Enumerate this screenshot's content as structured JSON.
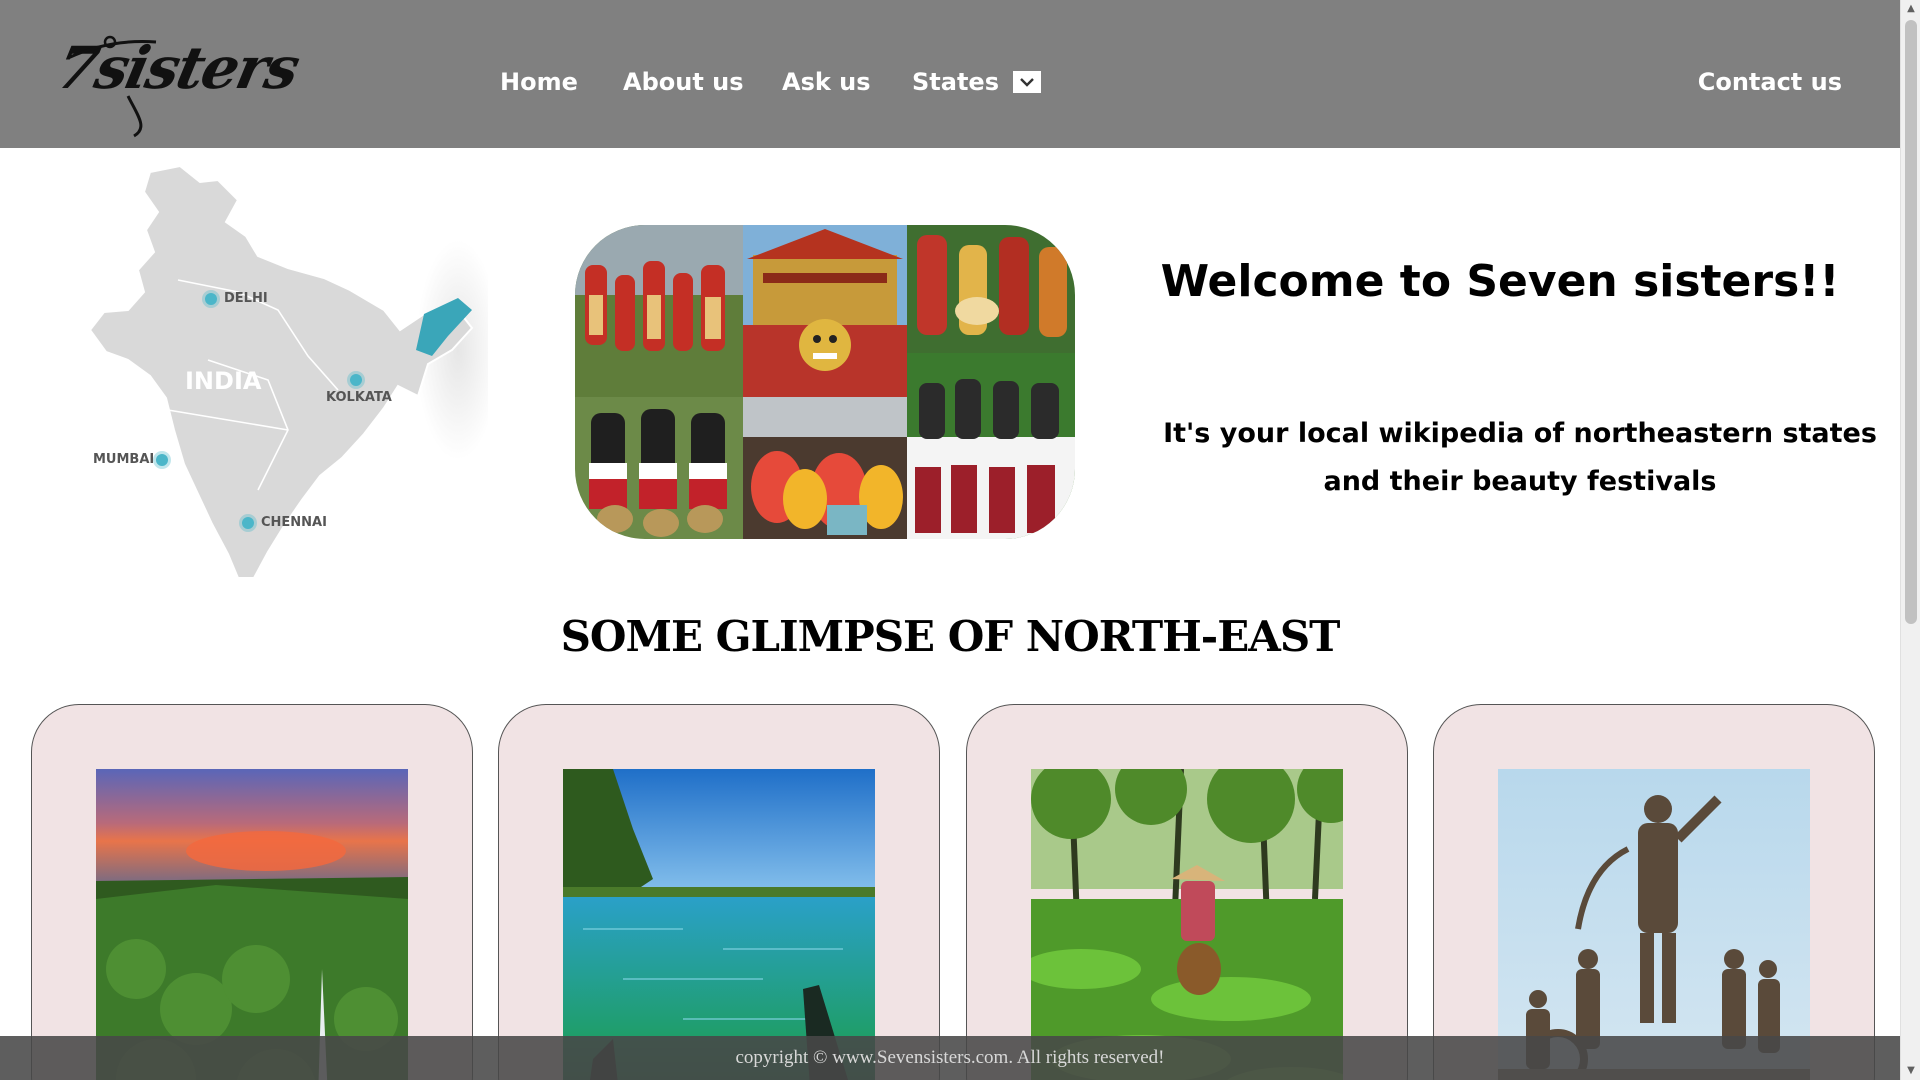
{
  "header": {
    "logo_text": "7sisters",
    "nav": {
      "home": "Home",
      "about": "About us",
      "ask": "Ask us",
      "states": "States",
      "contact": "Contact us"
    }
  },
  "hero": {
    "map": {
      "country": "INDIA",
      "cities": [
        "DELHI",
        "KOLKATA",
        "MUMBAI",
        "CHENNAI"
      ],
      "highlight_color": "#3aa6b9"
    },
    "welcome_title": "Welcome to Seven sisters!!",
    "welcome_subtitle": "It's your local wikipedia of northeastern states and their beauty festivals"
  },
  "glimpse": {
    "title": "SOME GLIMPSE OF NORTH-EAST",
    "cards": [
      {
        "subject": "waterfall-sunset"
      },
      {
        "subject": "river-lake"
      },
      {
        "subject": "tea-garden"
      },
      {
        "subject": "warrior-statues"
      }
    ]
  },
  "footer": {
    "copyright": "copyright © www.Sevensisters.com. All rights reserved!"
  },
  "colors": {
    "header_bg": "#808080",
    "card_bg": "#f1e3e4",
    "footer_bg": "#484848"
  }
}
